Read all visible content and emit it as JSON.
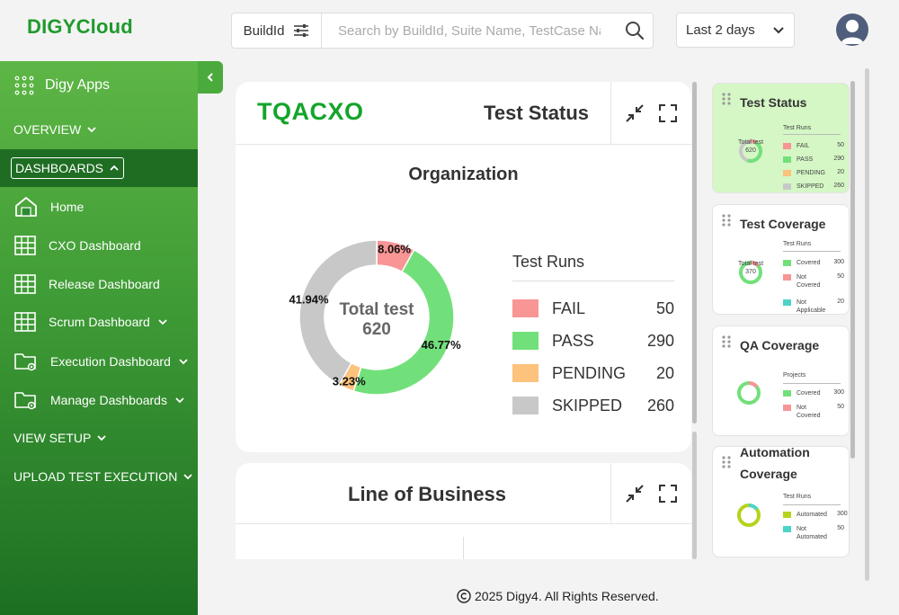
{
  "app": {
    "logo": "DIGYCloud"
  },
  "search": {
    "filter_type": "BuildId",
    "placeholder": "Search by BuildId, Suite Name, TestCase Name"
  },
  "date_range": {
    "selected": "Last 2 days"
  },
  "sidebar": {
    "apps_label": "Digy Apps",
    "overview": "OVERVIEW",
    "dashboards": "DASHBOARDS",
    "items": [
      {
        "label": "Home",
        "icon": "home-icon"
      },
      {
        "label": "CXO Dashboard",
        "icon": "grid-icon"
      },
      {
        "label": "Release Dashboard",
        "icon": "grid-icon"
      },
      {
        "label": "Scrum Dashboard",
        "icon": "grid-icon"
      },
      {
        "label": "Execution Dashboard",
        "icon": "folder-gear-icon"
      },
      {
        "label": "Manage Dashboards",
        "icon": "folder-gear-icon"
      }
    ],
    "view_setup": "VIEW SETUP",
    "upload": "UPLOAD TEST EXECUTION"
  },
  "main": {
    "brand": "TQACXO",
    "card1_title": "Test Status",
    "org_title": "Organization",
    "total_label": "Total test",
    "total_value": "620",
    "legend_title": "Test Runs",
    "card2_title": "Line of Business"
  },
  "chart_data": {
    "type": "pie",
    "variant": "donut",
    "categories": [
      "FAIL",
      "PASS",
      "PENDING",
      "SKIPPED"
    ],
    "values": [
      50,
      290,
      20,
      260
    ],
    "percent_labels": [
      "8.06%",
      "46.77%",
      "3.23%",
      "41.94%"
    ],
    "colors": [
      "#f89595",
      "#72e07a",
      "#fdc27c",
      "#c8c8c8"
    ],
    "center_label": "Total test",
    "center_value": "620",
    "legend_title": "Test Runs",
    "legend_placement": "right"
  },
  "right_panel": {
    "cards": [
      {
        "title": "Test Status",
        "legend_title": "Test Runs",
        "center": "Total test 620",
        "rows": [
          {
            "label": "FAIL",
            "value": "50",
            "color": "#f89595"
          },
          {
            "label": "PASS",
            "value": "290",
            "color": "#72e07a"
          },
          {
            "label": "PENDING",
            "value": "20",
            "color": "#fdc27c"
          },
          {
            "label": "SKIPPED",
            "value": "260",
            "color": "#c8c8c8"
          }
        ]
      },
      {
        "title": "Test Coverage",
        "legend_title": "Test Runs",
        "center": "Total test 370",
        "rows": [
          {
            "label": "Covered",
            "value": "300",
            "color": "#72e07a"
          },
          {
            "label": "Not Covered",
            "value": "50",
            "color": "#f89595"
          },
          {
            "label": "Not Applicable",
            "value": "20",
            "color": "#4dd4c8"
          }
        ]
      },
      {
        "title": "QA Coverage",
        "legend_title": "Projects",
        "rows": [
          {
            "label": "Covered",
            "value": "300",
            "color": "#72e07a"
          },
          {
            "label": "Not Covered",
            "value": "50",
            "color": "#f89595"
          }
        ]
      },
      {
        "title": "Automation Coverage",
        "legend_title": "Test Runs",
        "rows": [
          {
            "label": "Automated",
            "value": "300",
            "color": "#b5d31c"
          },
          {
            "label": "Not Automated",
            "value": "50",
            "color": "#4dd4c8"
          }
        ]
      }
    ]
  },
  "footer": {
    "text": "2025 Digy4. All Rights Reserved."
  }
}
